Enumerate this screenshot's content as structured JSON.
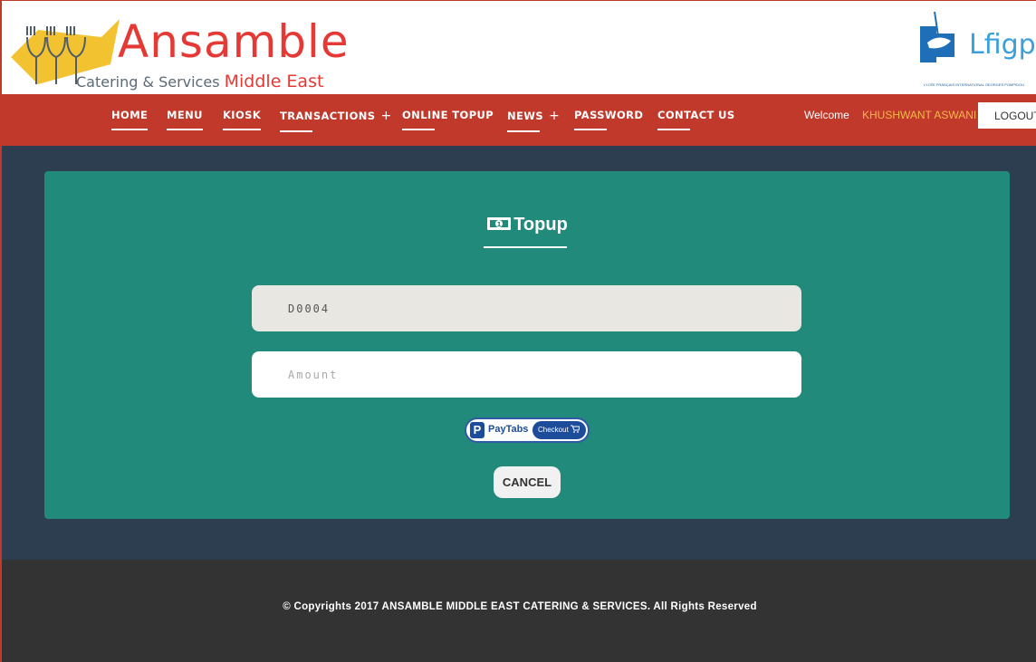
{
  "brand": {
    "name": "Ansamble",
    "tagline_prefix": "Catering & Services",
    "tagline_accent": "Middle East",
    "partner_logo_text": "Lfigp",
    "partner_logo_small": "LYCÉE FRANÇAIS INTERNATIONAL GEORGES POMPIDOU"
  },
  "nav": {
    "home": "HOME",
    "menu": "MENU",
    "kiosk": "KIOSK",
    "transactions": "TRANSACTIONS",
    "transactions_plus": "+",
    "online_topup": "ONLINE TOPUP",
    "news": "NEWS",
    "news_plus": "+",
    "password": "PASSWORD",
    "contact": "CONTACT US",
    "welcome": "Welcome",
    "username": "KHUSHWANT ASWANI",
    "logout": "LOGOUT"
  },
  "topup": {
    "title": "Topup",
    "code_value": "D0004",
    "amount_placeholder": "Amount",
    "paytabs_brand": "PayTabs",
    "paytabs_checkout": "Checkout",
    "cancel": "CANCEL"
  },
  "footer": {
    "copyright": "© Copyrights 2017 ANSAMBLE MIDDLE EAST CATERING & SERVICES. All Rights Reserved"
  },
  "colors": {
    "nav_bg": "#c0392b",
    "page_bg": "#2c3e50",
    "card_bg": "#218a7b",
    "footer_bg": "#333333",
    "username": "#f5b94a"
  }
}
